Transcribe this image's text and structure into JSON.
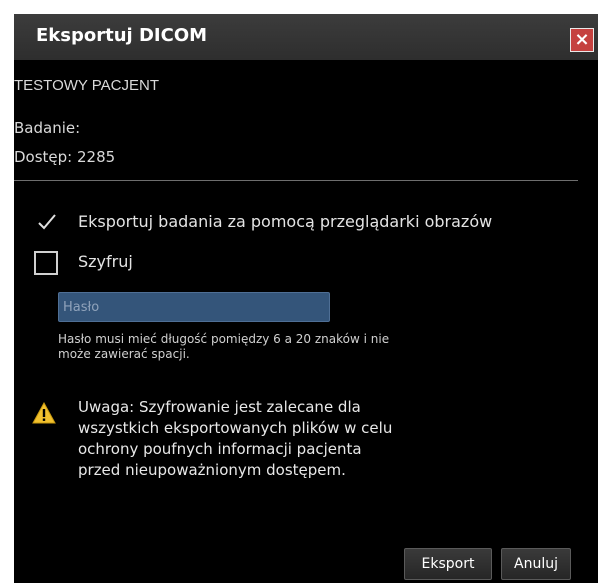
{
  "dialog": {
    "title": "Eksportuj DICOM",
    "close_symbol": "×",
    "patient_name": "TESTOWY PACJENT",
    "study_label": "Badanie:",
    "access_label": "Dostęp: 2285",
    "export_with_viewer": {
      "label": "Eksportuj badania za pomocą przeglądarki obrazów",
      "checked": true,
      "icon": "check-icon"
    },
    "encrypt": {
      "label": "Szyfruj",
      "checked": false
    },
    "password": {
      "placeholder": "Hasło",
      "value": ""
    },
    "password_hint_line1": "Hasło musi mieć długość pomiędzy 6 a 20 znaków i nie",
    "password_hint_line2": "może zawierać spacji.",
    "warning": {
      "icon": "warning-icon",
      "line1": "Uwaga: Szyfrowanie jest zalecane dla",
      "line2": "wszystkich eksportowanych plików w celu",
      "line3": "ochrony poufnych informacji pacjenta",
      "line4": "przed nieupoważnionym dostępem."
    },
    "buttons": {
      "export": "Eksport",
      "cancel": "Anuluj"
    }
  },
  "colors": {
    "background": "#000000",
    "titlebar": "#333333",
    "close_button": "#c5413f",
    "input": "#34557a",
    "warning_icon": "#f2c12e"
  }
}
